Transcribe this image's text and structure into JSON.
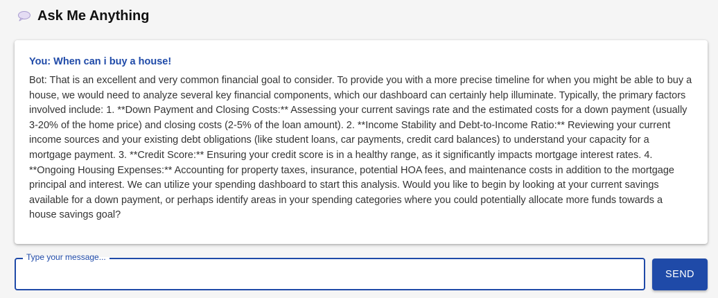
{
  "header": {
    "icon": "speech-balloon-icon",
    "title": "Ask Me Anything"
  },
  "conversation": {
    "user_message": "You: When can i buy a house!",
    "bot_message": "Bot: That is an excellent and very common financial goal to consider. To provide you with a more precise timeline for when you might be able to buy a house, we would need to analyze several key financial components, which our dashboard can certainly help illuminate. Typically, the primary factors involved include: 1. **Down Payment and Closing Costs:** Assessing your current savings rate and the estimated costs for a down payment (usually 3-20% of the home price) and closing costs (2-5% of the loan amount). 2. **Income Stability and Debt-to-Income Ratio:** Reviewing your current income sources and your existing debt obligations (like student loans, car payments, credit card balances) to understand your capacity for a mortgage payment. 3. **Credit Score:** Ensuring your credit score is in a healthy range, as it significantly impacts mortgage interest rates. 4. **Ongoing Housing Expenses:** Accounting for property taxes, insurance, potential HOA fees, and maintenance costs in addition to the mortgage principal and interest. We can utilize your spending dashboard to start this analysis. Would you like to begin by looking at your current savings available for a down payment, or perhaps identify areas in your spending categories where you could potentially allocate more funds towards a house savings goal?"
  },
  "composer": {
    "label": "Type your message...",
    "value": "",
    "send_label": "SEND"
  },
  "colors": {
    "accent": "#1f4aa8",
    "background": "#f5f5f5",
    "card": "#ffffff"
  }
}
